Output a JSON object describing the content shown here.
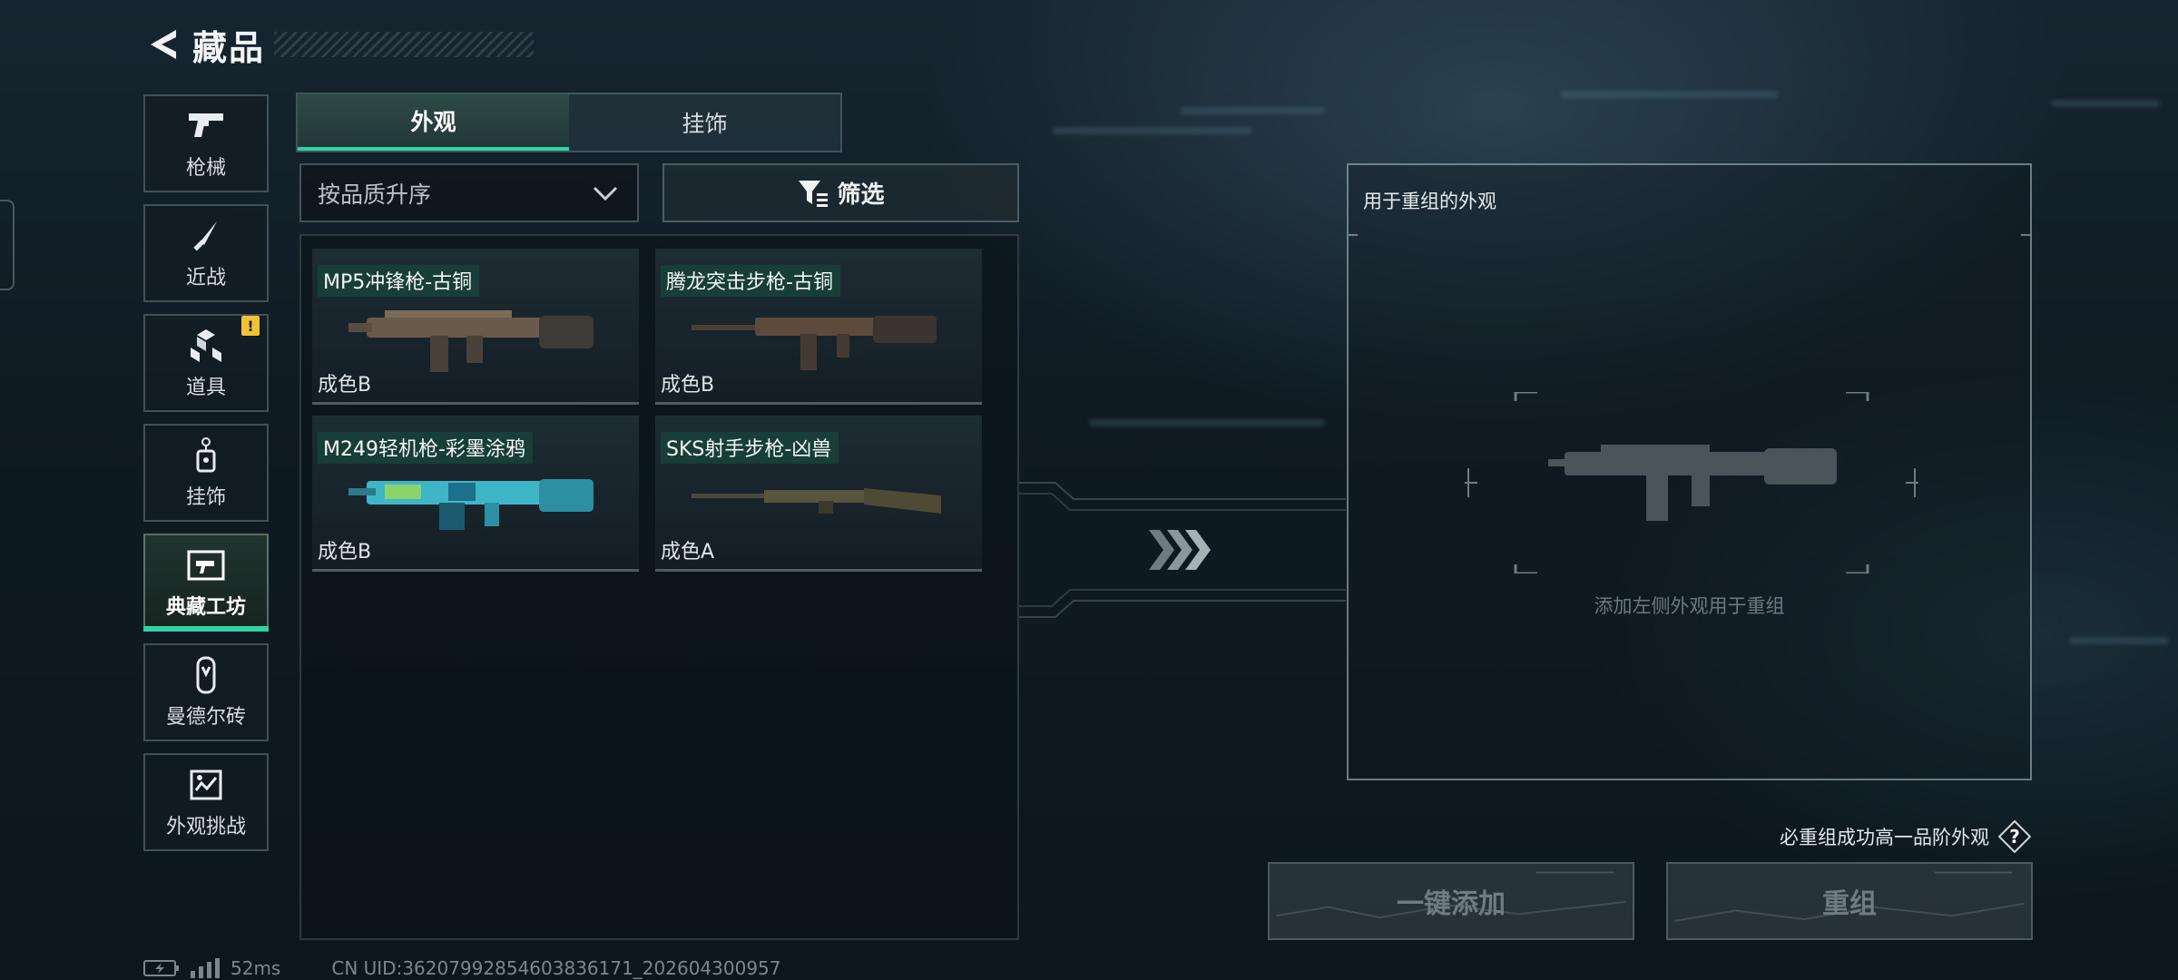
{
  "header": {
    "title": "藏品",
    "back_icon": "back-arrow-icon"
  },
  "sidebar": {
    "items": [
      {
        "label": "枪械",
        "icon": "pistol-icon"
      },
      {
        "label": "近战",
        "icon": "knife-icon"
      },
      {
        "label": "道具",
        "icon": "cubes-icon",
        "badge": "!"
      },
      {
        "label": "挂饰",
        "icon": "charm-tag-icon"
      },
      {
        "label": "典藏工坊",
        "icon": "workshop-icon",
        "active": true
      },
      {
        "label": "曼德尔砖",
        "icon": "mandel-brick-icon"
      },
      {
        "label": "外观挑战",
        "icon": "challenge-map-icon"
      }
    ]
  },
  "tabs": [
    {
      "label": "外观",
      "active": true
    },
    {
      "label": "挂饰",
      "active": false
    }
  ],
  "sort": {
    "value": "按品质升序"
  },
  "filter": {
    "label": "筛选"
  },
  "items": [
    {
      "name": "MP5冲锋枪-古铜",
      "quality": "成色B"
    },
    {
      "name": "腾龙突击步枪-古铜",
      "quality": "成色B"
    },
    {
      "name": "M249轻机枪-彩墨涂鸦",
      "quality": "成色B"
    },
    {
      "name": "SKS射手步枪-凶兽",
      "quality": "成色A"
    }
  ],
  "recompose": {
    "panel_title": "用于重组的外观",
    "hint": "添加左侧外观用于重组",
    "note": "必重组成功高一品阶外观",
    "help_label": "?",
    "add_all_label": "一键添加",
    "recompose_label": "重组"
  },
  "status": {
    "ping": "52ms",
    "uid": "CN UID:36207992854603836171_202604300957"
  },
  "colors": {
    "accent": "#2fd4a4",
    "badge": "#f2c230"
  }
}
